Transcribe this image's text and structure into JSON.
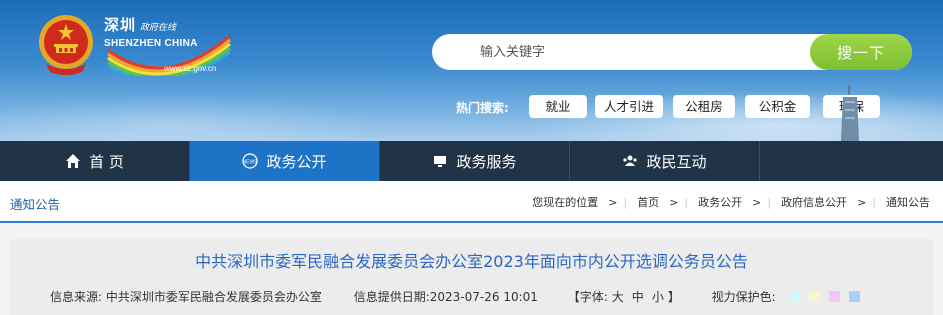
{
  "site": {
    "logo_cn": "深圳",
    "logo_cn_sub": "政府在线",
    "logo_en": "SHENZHEN CHINA",
    "logo_url": "www.sz.gov.cn"
  },
  "search": {
    "placeholder": "输入关键字",
    "button_label": "搜一下"
  },
  "hot_search": {
    "label": "热门搜索:",
    "tags": [
      "就业",
      "人才引进",
      "公租房",
      "公积金",
      "环保"
    ]
  },
  "nav": {
    "items": [
      {
        "label": "首 页",
        "icon": "home-icon",
        "active": false
      },
      {
        "label": "政务公开",
        "icon": "news-icon",
        "active": true
      },
      {
        "label": "政务服务",
        "icon": "monitor-icon",
        "active": false
      },
      {
        "label": "政民互动",
        "icon": "people-icon",
        "active": false
      }
    ]
  },
  "breadcrumb": {
    "section_title": "通知公告",
    "items": [
      "您现在的位置",
      "首页",
      "政务公开",
      "政府信息公开",
      "通知公告"
    ]
  },
  "article": {
    "title": "中共深圳市委军民融合发展委员会办公室2023年面向市内公开选调公务员公告",
    "source_label": "信息来源:",
    "source_value": "中共深圳市委军民融合发展委员会办公室",
    "date_label": "信息提供日期:",
    "date_value": "2023-07-26 10:01",
    "font_label": "【字体:",
    "font_large": "大",
    "font_medium": "中",
    "font_small": "小",
    "font_close": "】",
    "eye_label": "视力保护色:",
    "eye_colors": [
      "#d6f6ff",
      "#f6f6c8",
      "#f5c6f5",
      "#a9d1f7"
    ]
  },
  "colors": {
    "header_top": "#1c6cb8",
    "nav_bg": "#213346",
    "nav_active": "#1d74c6",
    "search_button": "#8bc83a",
    "title_blue": "#2d67c2"
  }
}
